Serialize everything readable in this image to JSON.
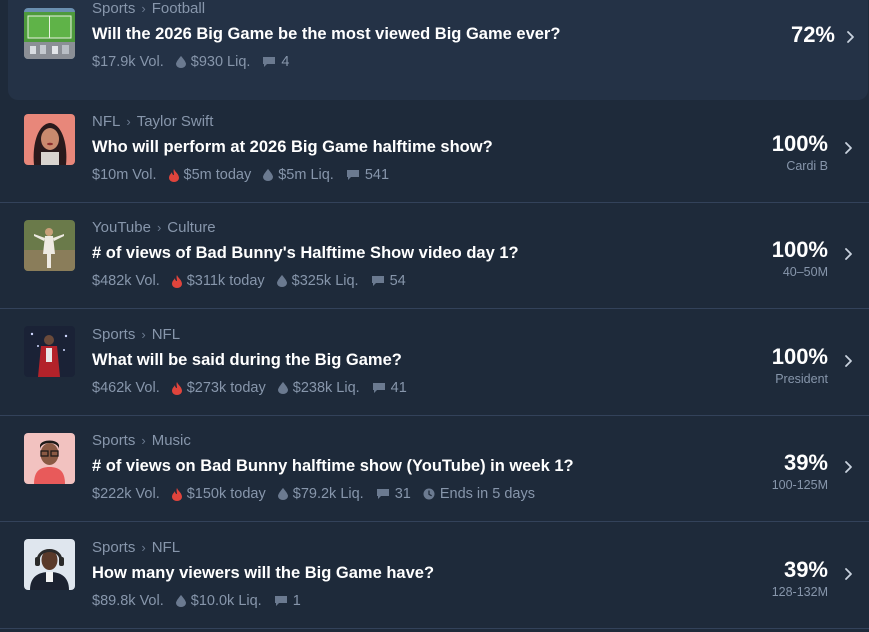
{
  "markets": [
    {
      "crumbs": [
        "Sports",
        "Football"
      ],
      "title": "Will the 2026 Big Game be the most viewed Big Game ever?",
      "volume": "$17.9k Vol.",
      "today": "",
      "liquidity": "$930 Liq.",
      "comments": "4",
      "ends": "",
      "percent": "72%",
      "sublabel": "",
      "thumb": "football-field-thumbnail"
    },
    {
      "crumbs": [
        "NFL",
        "Taylor Swift"
      ],
      "title": "Who will perform at 2026 Big Game halftime show?",
      "volume": "$10m Vol.",
      "today": "$5m today",
      "liquidity": "$5m Liq.",
      "comments": "541",
      "ends": "",
      "percent": "100%",
      "sublabel": "Cardi B",
      "thumb": "cardi-b-portrait-thumbnail"
    },
    {
      "crumbs": [
        "YouTube",
        "Culture"
      ],
      "title": "# of views of Bad Bunny's Halftime Show video day 1?",
      "volume": "$482k Vol.",
      "today": "$311k today",
      "liquidity": "$325k Liq.",
      "comments": "54",
      "ends": "",
      "percent": "100%",
      "sublabel": "40–50M",
      "thumb": "bad-bunny-stage-thumbnail"
    },
    {
      "crumbs": [
        "Sports",
        "NFL"
      ],
      "title": "What will be said during the Big Game?",
      "volume": "$462k Vol.",
      "today": "$273k today",
      "liquidity": "$238k Liq.",
      "comments": "41",
      "ends": "",
      "percent": "100%",
      "sublabel": "President",
      "thumb": "stadium-performer-thumbnail"
    },
    {
      "crumbs": [
        "Sports",
        "Music"
      ],
      "title": "# of views on Bad Bunny halftime show (YouTube) in week 1?",
      "volume": "$222k Vol.",
      "today": "$150k today",
      "liquidity": "$79.2k Liq.",
      "comments": "31",
      "ends": "Ends in 5 days",
      "percent": "39%",
      "sublabel": "100-125M",
      "thumb": "man-with-glasses-thumbnail"
    },
    {
      "crumbs": [
        "Sports",
        "NFL"
      ],
      "title": "How many viewers will the Big Game have?",
      "volume": "$89.8k Vol.",
      "today": "",
      "liquidity": "$10.0k Liq.",
      "comments": "1",
      "ends": "",
      "percent": "39%",
      "sublabel": "128-132M",
      "thumb": "announcer-headset-thumbnail"
    }
  ],
  "colors": {
    "background": "#1e2a3a",
    "highlight_row": "#243246",
    "muted_text": "#8796ab",
    "fire_icon": "#e0443c"
  },
  "icons": {
    "liquidity": "droplet-icon",
    "comments": "comment-icon",
    "today": "fire-icon",
    "ends": "clock-icon",
    "row_action": "chevron-right-icon"
  }
}
